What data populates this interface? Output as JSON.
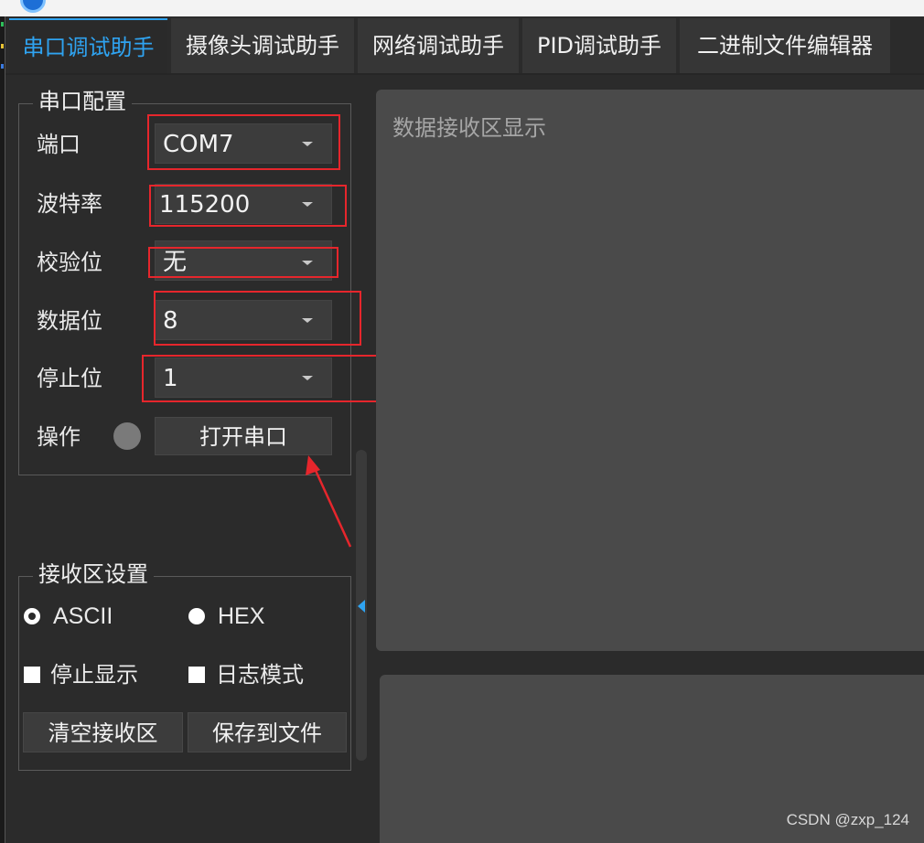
{
  "window": {
    "title": "串口调试助手"
  },
  "tabs": [
    {
      "label": "串口调试助手",
      "active": true
    },
    {
      "label": "摄像头调试助手",
      "active": false
    },
    {
      "label": "网络调试助手",
      "active": false
    },
    {
      "label": "PID调试助手",
      "active": false
    },
    {
      "label": "二进制文件编辑器",
      "active": false
    }
  ],
  "serial_config": {
    "title": "串口配置",
    "port": {
      "label": "端口",
      "value": "COM7"
    },
    "baud": {
      "label": "波特率",
      "value": "115200"
    },
    "parity": {
      "label": "校验位",
      "value": "无"
    },
    "data_bits": {
      "label": "数据位",
      "value": "8"
    },
    "stop_bits": {
      "label": "停止位",
      "value": "1"
    },
    "operation": {
      "label": "操作",
      "status": "closed",
      "button_label": "打开串口"
    }
  },
  "receive_settings": {
    "title": "接收区设置",
    "mode_ascii": {
      "label": "ASCII",
      "checked": true
    },
    "mode_hex": {
      "label": "HEX",
      "checked": false
    },
    "stop_display": {
      "label": "停止显示",
      "checked": false
    },
    "log_mode": {
      "label": "日志模式",
      "checked": false
    },
    "clear_button": "清空接收区",
    "save_button": "保存到文件"
  },
  "receive_area": {
    "placeholder": "数据接收区显示"
  },
  "watermark": "CSDN @zxp_124",
  "colors": {
    "accent": "#2fa3f0",
    "background": "#2b2b2b",
    "panel": "#4a4a4a",
    "annotation_red": "#e6262c"
  }
}
